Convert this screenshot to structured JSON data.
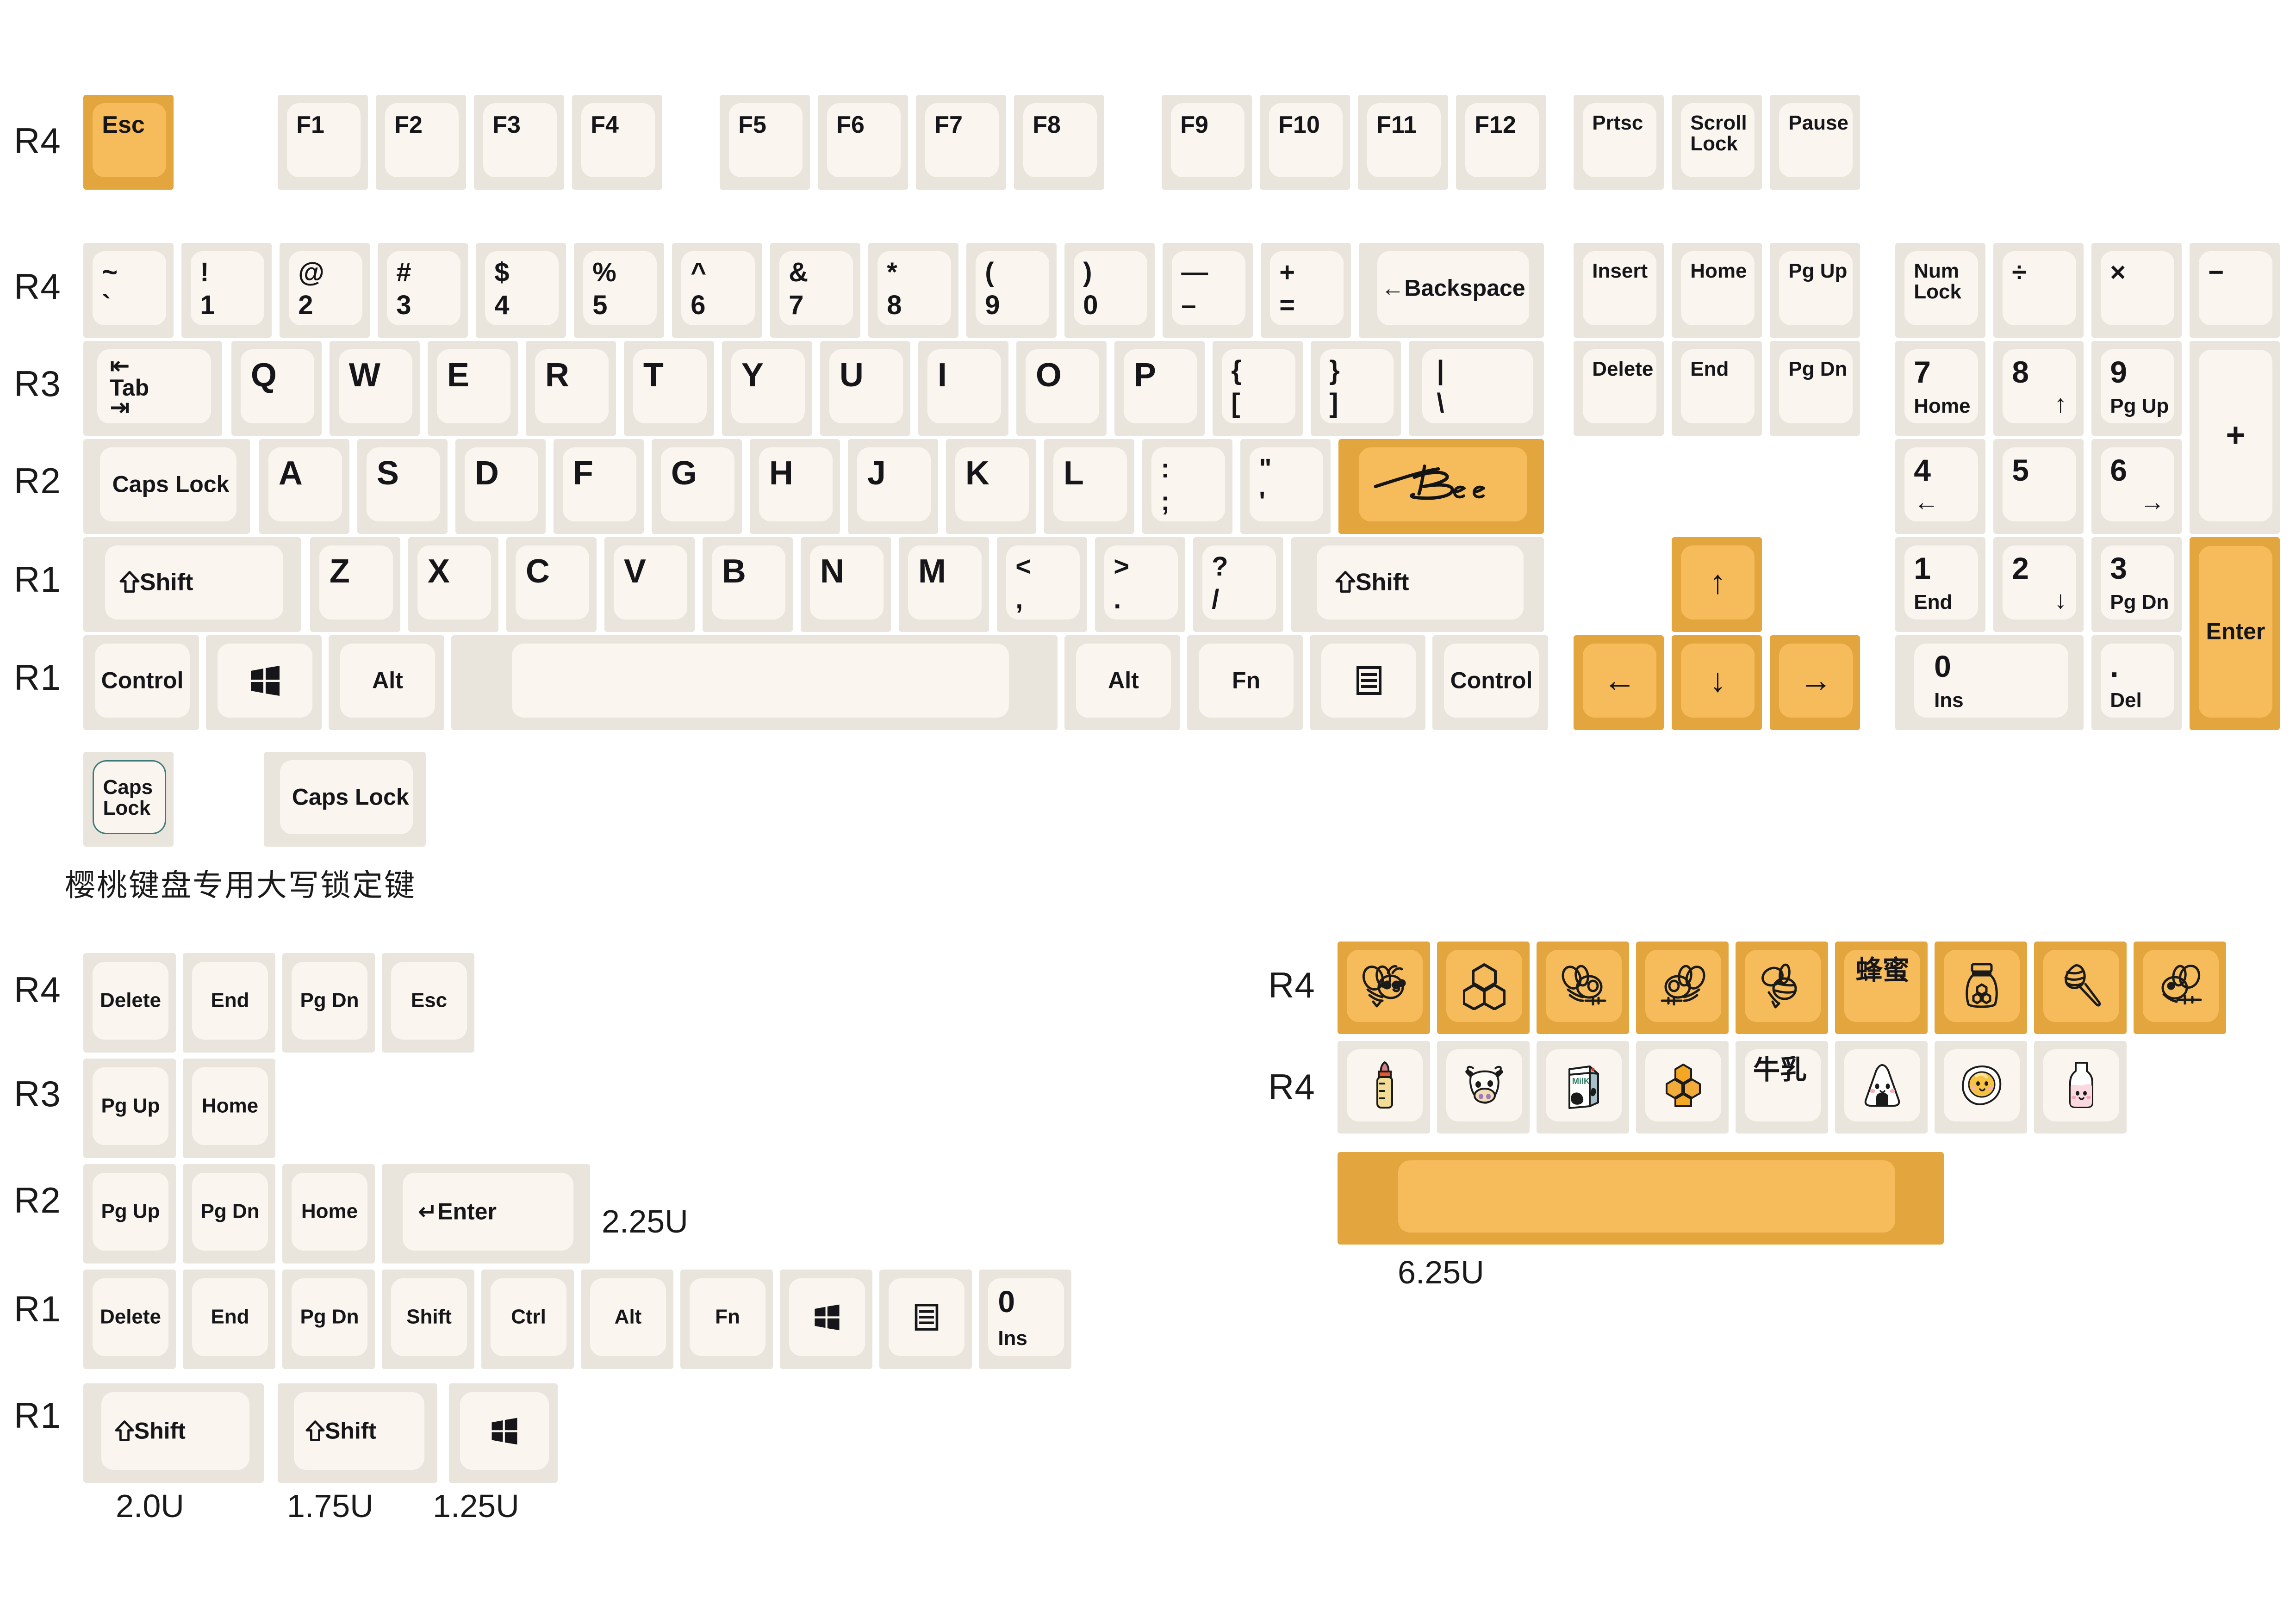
{
  "meta": {
    "title": "Bee & Milk Keycap Set Layout",
    "colors": {
      "key_base": "#e9e5dd",
      "key_top": "#faf6ef",
      "accent_base": "#e3a63f",
      "accent_top": "#f6bc5c",
      "legend": "#16161a",
      "outline": "#3f7a7a"
    }
  },
  "row_labels": {
    "main": [
      "R4",
      "R4",
      "R3",
      "R2",
      "R1",
      "R1"
    ],
    "extras_left": [
      "R4",
      "R3",
      "R2",
      "R1",
      "R1"
    ],
    "novelty": [
      "R4",
      "R4"
    ]
  },
  "captions": {
    "cherry_caps": "樱桃键盘专用大写锁定键",
    "u_225": "2.25U",
    "u_200": "2.0U",
    "u_175": "1.75U",
    "u_125": "1.25U",
    "u_625": "6.25U"
  },
  "function_row": {
    "esc": "Esc",
    "f_group_1": [
      "F1",
      "F2",
      "F3",
      "F4"
    ],
    "f_group_2": [
      "F5",
      "F6",
      "F7",
      "F8"
    ],
    "f_group_3": [
      "F9",
      "F10",
      "F11",
      "F12"
    ],
    "nav": [
      "Prtsc",
      "Scroll\nLock",
      "Pause"
    ]
  },
  "number_row": [
    {
      "top": "~",
      "bottom": "`"
    },
    {
      "top": "!",
      "bottom": "1"
    },
    {
      "top": "@",
      "bottom": "2"
    },
    {
      "top": "#",
      "bottom": "3"
    },
    {
      "top": "$",
      "bottom": "4"
    },
    {
      "top": "%",
      "bottom": "5"
    },
    {
      "top": "^",
      "bottom": "6"
    },
    {
      "top": "&",
      "bottom": "7"
    },
    {
      "top": "*",
      "bottom": "8"
    },
    {
      "top": "(",
      "bottom": "9"
    },
    {
      "top": ")",
      "bottom": "0"
    },
    {
      "top": "—",
      "bottom": "–"
    },
    {
      "top": "+",
      "bottom": "="
    }
  ],
  "backspace": "←Backspace",
  "row_q": {
    "tab": "Tab",
    "tab_glyph_top": "⇤",
    "tab_glyph_bottom": "⇥",
    "letters": [
      "Q",
      "W",
      "E",
      "R",
      "T",
      "Y",
      "U",
      "I",
      "O",
      "P"
    ],
    "brackets": [
      {
        "top": "{",
        "bottom": "["
      },
      {
        "top": "}",
        "bottom": "]"
      },
      {
        "top": "|",
        "bottom": "\\"
      }
    ]
  },
  "row_a": {
    "caps": "Caps Lock",
    "letters": [
      "A",
      "S",
      "D",
      "F",
      "G",
      "H",
      "J",
      "K",
      "L"
    ],
    "punct": [
      {
        "top": ":",
        "bottom": ";"
      },
      {
        "top": "\"",
        "bottom": "'"
      }
    ],
    "enter_label": "Bee"
  },
  "row_z": {
    "shift_left": "Shift",
    "letters": [
      "Z",
      "X",
      "C",
      "V",
      "B",
      "N",
      "M"
    ],
    "punct": [
      {
        "top": "<",
        "bottom": ","
      },
      {
        "top": ">",
        "bottom": "."
      },
      {
        "top": "?",
        "bottom": "/"
      }
    ],
    "shift_right": "Shift"
  },
  "bottom_row": {
    "control_left": "Control",
    "win_left": "win-logo",
    "alt_left": "Alt",
    "space": "",
    "alt_right": "Alt",
    "fn": "Fn",
    "menu": "menu-icon",
    "control_right": "Control"
  },
  "nav_cluster": {
    "col1": [
      "Insert",
      "Delete"
    ],
    "col2": [
      "Home",
      "End"
    ],
    "col3": [
      "Pg Up",
      "Pg Dn"
    ],
    "arrows": {
      "up": "↑",
      "left": "←",
      "down": "↓",
      "right": "→"
    }
  },
  "numpad": {
    "row1": [
      {
        "main": "Num\nLock"
      },
      {
        "main": "÷"
      },
      {
        "main": "×"
      },
      {
        "main": "−"
      }
    ],
    "row2": [
      {
        "main": "7",
        "sub": "Home"
      },
      {
        "main": "8",
        "sub": "↑"
      },
      {
        "main": "9",
        "sub": "Pg Up"
      }
    ],
    "plus": "+",
    "row3": [
      {
        "main": "4",
        "sub": "←"
      },
      {
        "main": "5",
        "sub": ""
      },
      {
        "main": "6",
        "sub": "→"
      }
    ],
    "row4": [
      {
        "main": "1",
        "sub": "End"
      },
      {
        "main": "2",
        "sub": "↓"
      },
      {
        "main": "3",
        "sub": "Pg Dn"
      }
    ],
    "row5": [
      {
        "main": "0",
        "sub": "Ins"
      },
      {
        "main": ".",
        "sub": "Del"
      }
    ],
    "enter": "Enter"
  },
  "caps_variants": [
    {
      "label": "Caps\nLock",
      "outlined": true
    },
    {
      "label": "Caps Lock",
      "outlined": false
    }
  ],
  "extras_left": {
    "r4": [
      "Delete",
      "End",
      "Pg Dn",
      "Esc"
    ],
    "r3": [
      "Pg Up",
      "Home"
    ],
    "r2": [
      "Pg Up",
      "Pg Dn",
      "Home",
      "↵Enter"
    ],
    "r1a": [
      {
        "main": "Delete"
      },
      {
        "main": "End"
      },
      {
        "main": "Pg Dn"
      },
      {
        "main": "Shift"
      },
      {
        "main": "Ctrl"
      },
      {
        "main": "Alt"
      },
      {
        "main": "Fn"
      },
      {
        "main": "win-logo"
      },
      {
        "main": "menu-icon"
      },
      {
        "main": "0",
        "sub": "Ins"
      }
    ],
    "r1b": [
      {
        "label": "Shift",
        "shift": true
      },
      {
        "label": "Shift",
        "shift": true
      },
      {
        "label": "win-logo",
        "shift": false
      }
    ]
  },
  "novelty": {
    "row_orange": [
      {
        "icon": "bee-happy-icon",
        "label": ""
      },
      {
        "icon": "honeycomb-cells-icon",
        "label": ""
      },
      {
        "icon": "bee-flying-left-icon",
        "label": ""
      },
      {
        "icon": "bee-flying-right-icon",
        "label": ""
      },
      {
        "icon": "bee-side-icon",
        "label": ""
      },
      {
        "icon": "",
        "label": "蜂蜜"
      },
      {
        "icon": "honey-jar-icon",
        "label": ""
      },
      {
        "icon": "honey-dipper-icon",
        "label": ""
      },
      {
        "icon": "bee-wings-icon",
        "label": ""
      }
    ],
    "row_cream": [
      {
        "icon": "baby-bottle-icon",
        "label": ""
      },
      {
        "icon": "cow-face-icon",
        "label": ""
      },
      {
        "icon": "milk-carton-icon",
        "label": ""
      },
      {
        "icon": "honeycomb-orange-icon",
        "label": ""
      },
      {
        "icon": "",
        "label": "牛乳"
      },
      {
        "icon": "onigiri-icon",
        "label": ""
      },
      {
        "icon": "fried-egg-icon",
        "label": ""
      },
      {
        "icon": "milk-bottle-icon",
        "label": ""
      }
    ],
    "spacebar": ""
  }
}
